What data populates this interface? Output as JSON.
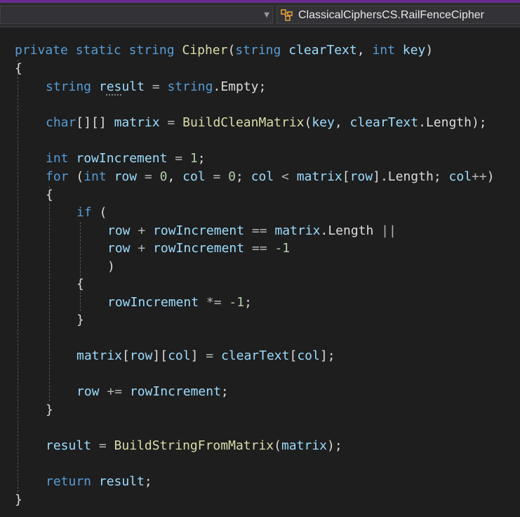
{
  "navbar": {
    "class_name": "ClassicalCiphersCS.RailFenceCipher",
    "class_icon": "class-icon"
  },
  "code": [
    {
      "line": 1,
      "indent": 0,
      "tokens": [
        {
          "t": "private",
          "c": "kw"
        },
        {
          "t": " ",
          "c": "pn"
        },
        {
          "t": "static",
          "c": "kw"
        },
        {
          "t": " ",
          "c": "pn"
        },
        {
          "t": "string",
          "c": "ty"
        },
        {
          "t": " ",
          "c": "pn"
        },
        {
          "t": "Cipher",
          "c": "fn"
        },
        {
          "t": "(",
          "c": "pn"
        },
        {
          "t": "string",
          "c": "ty"
        },
        {
          "t": " ",
          "c": "pn"
        },
        {
          "t": "clearText",
          "c": "vr"
        },
        {
          "t": ", ",
          "c": "pn"
        },
        {
          "t": "int",
          "c": "ty"
        },
        {
          "t": " ",
          "c": "pn"
        },
        {
          "t": "key",
          "c": "vr"
        },
        {
          "t": ")",
          "c": "pn"
        }
      ]
    },
    {
      "line": 2,
      "indent": 0,
      "tokens": [
        {
          "t": "{",
          "c": "pn"
        }
      ]
    },
    {
      "line": 3,
      "indent": 1,
      "tokens": [
        {
          "t": "string",
          "c": "ty"
        },
        {
          "t": " ",
          "c": "pn"
        },
        {
          "t": "r",
          "c": "vr"
        },
        {
          "t": "es",
          "c": "vr",
          "squiggle": true
        },
        {
          "t": "ult",
          "c": "vr"
        },
        {
          "t": " = ",
          "c": "op"
        },
        {
          "t": "string",
          "c": "ty"
        },
        {
          "t": ".",
          "c": "pn"
        },
        {
          "t": "Empty",
          "c": "pn"
        },
        {
          "t": ";",
          "c": "pn"
        }
      ]
    },
    {
      "line": 4,
      "indent": 0,
      "tokens": []
    },
    {
      "line": 5,
      "indent": 1,
      "tokens": [
        {
          "t": "char",
          "c": "ty"
        },
        {
          "t": "[][]",
          "c": "pn"
        },
        {
          "t": " ",
          "c": "pn"
        },
        {
          "t": "matrix",
          "c": "vr"
        },
        {
          "t": " = ",
          "c": "op"
        },
        {
          "t": "BuildCleanMatrix",
          "c": "fn"
        },
        {
          "t": "(",
          "c": "pn"
        },
        {
          "t": "key",
          "c": "vr"
        },
        {
          "t": ", ",
          "c": "pn"
        },
        {
          "t": "clearText",
          "c": "vr"
        },
        {
          "t": ".",
          "c": "pn"
        },
        {
          "t": "Length",
          "c": "pn"
        },
        {
          "t": ");",
          "c": "pn"
        }
      ]
    },
    {
      "line": 6,
      "indent": 0,
      "tokens": []
    },
    {
      "line": 7,
      "indent": 1,
      "tokens": [
        {
          "t": "int",
          "c": "ty"
        },
        {
          "t": " ",
          "c": "pn"
        },
        {
          "t": "rowIncrement",
          "c": "vr"
        },
        {
          "t": " = ",
          "c": "op"
        },
        {
          "t": "1",
          "c": "nm"
        },
        {
          "t": ";",
          "c": "pn"
        }
      ]
    },
    {
      "line": 8,
      "indent": 1,
      "tokens": [
        {
          "t": "for",
          "c": "kw"
        },
        {
          "t": " (",
          "c": "pn"
        },
        {
          "t": "int",
          "c": "ty"
        },
        {
          "t": " ",
          "c": "pn"
        },
        {
          "t": "row",
          "c": "vr"
        },
        {
          "t": " = ",
          "c": "op"
        },
        {
          "t": "0",
          "c": "nm"
        },
        {
          "t": ", ",
          "c": "pn"
        },
        {
          "t": "col",
          "c": "vr"
        },
        {
          "t": " = ",
          "c": "op"
        },
        {
          "t": "0",
          "c": "nm"
        },
        {
          "t": "; ",
          "c": "pn"
        },
        {
          "t": "col",
          "c": "vr"
        },
        {
          "t": " < ",
          "c": "op"
        },
        {
          "t": "matrix",
          "c": "vr"
        },
        {
          "t": "[",
          "c": "pn"
        },
        {
          "t": "row",
          "c": "vr"
        },
        {
          "t": "].",
          "c": "pn"
        },
        {
          "t": "Length",
          "c": "pn"
        },
        {
          "t": "; ",
          "c": "pn"
        },
        {
          "t": "col",
          "c": "vr"
        },
        {
          "t": "++",
          "c": "op"
        },
        {
          "t": ")",
          "c": "pn"
        }
      ]
    },
    {
      "line": 9,
      "indent": 1,
      "tokens": [
        {
          "t": "{",
          "c": "pn"
        }
      ]
    },
    {
      "line": 10,
      "indent": 2,
      "tokens": [
        {
          "t": "if",
          "c": "kw"
        },
        {
          "t": " (",
          "c": "pn"
        }
      ]
    },
    {
      "line": 11,
      "indent": 3,
      "tokens": [
        {
          "t": "row",
          "c": "vr"
        },
        {
          "t": " + ",
          "c": "op"
        },
        {
          "t": "rowIncrement",
          "c": "vr"
        },
        {
          "t": " == ",
          "c": "op"
        },
        {
          "t": "matrix",
          "c": "vr"
        },
        {
          "t": ".",
          "c": "pn"
        },
        {
          "t": "Length",
          "c": "pn"
        },
        {
          "t": " ||",
          "c": "op"
        }
      ]
    },
    {
      "line": 12,
      "indent": 3,
      "tokens": [
        {
          "t": "row",
          "c": "vr"
        },
        {
          "t": " + ",
          "c": "op"
        },
        {
          "t": "rowIncrement",
          "c": "vr"
        },
        {
          "t": " == ",
          "c": "op"
        },
        {
          "t": "-1",
          "c": "nm"
        }
      ]
    },
    {
      "line": 13,
      "indent": 3,
      "tokens": [
        {
          "t": ")",
          "c": "pn"
        }
      ]
    },
    {
      "line": 14,
      "indent": 2,
      "tokens": [
        {
          "t": "{",
          "c": "pn"
        }
      ]
    },
    {
      "line": 15,
      "indent": 3,
      "tokens": [
        {
          "t": "rowIncrement",
          "c": "vr"
        },
        {
          "t": " *= ",
          "c": "op"
        },
        {
          "t": "-1",
          "c": "nm"
        },
        {
          "t": ";",
          "c": "pn"
        }
      ]
    },
    {
      "line": 16,
      "indent": 2,
      "tokens": [
        {
          "t": "}",
          "c": "pn"
        }
      ]
    },
    {
      "line": 17,
      "indent": 0,
      "tokens": []
    },
    {
      "line": 18,
      "indent": 2,
      "tokens": [
        {
          "t": "matrix",
          "c": "vr"
        },
        {
          "t": "[",
          "c": "pn"
        },
        {
          "t": "row",
          "c": "vr"
        },
        {
          "t": "][",
          "c": "pn"
        },
        {
          "t": "col",
          "c": "vr"
        },
        {
          "t": "]",
          "c": "pn"
        },
        {
          "t": " = ",
          "c": "op"
        },
        {
          "t": "clearText",
          "c": "vr"
        },
        {
          "t": "[",
          "c": "pn"
        },
        {
          "t": "col",
          "c": "vr"
        },
        {
          "t": "];",
          "c": "pn"
        }
      ]
    },
    {
      "line": 19,
      "indent": 0,
      "tokens": []
    },
    {
      "line": 20,
      "indent": 2,
      "tokens": [
        {
          "t": "row",
          "c": "vr"
        },
        {
          "t": " += ",
          "c": "op"
        },
        {
          "t": "rowIncrement",
          "c": "vr"
        },
        {
          "t": ";",
          "c": "pn"
        }
      ]
    },
    {
      "line": 21,
      "indent": 1,
      "tokens": [
        {
          "t": "}",
          "c": "pn"
        }
      ]
    },
    {
      "line": 22,
      "indent": 0,
      "tokens": []
    },
    {
      "line": 23,
      "indent": 1,
      "tokens": [
        {
          "t": "result",
          "c": "vr"
        },
        {
          "t": " = ",
          "c": "op"
        },
        {
          "t": "BuildStringFromMatrix",
          "c": "fn"
        },
        {
          "t": "(",
          "c": "pn"
        },
        {
          "t": "matrix",
          "c": "vr"
        },
        {
          "t": ");",
          "c": "pn"
        }
      ]
    },
    {
      "line": 24,
      "indent": 0,
      "tokens": []
    },
    {
      "line": 25,
      "indent": 1,
      "tokens": [
        {
          "t": "return",
          "c": "kw"
        },
        {
          "t": " ",
          "c": "pn"
        },
        {
          "t": "result",
          "c": "vr"
        },
        {
          "t": ";",
          "c": "pn"
        }
      ]
    },
    {
      "line": 26,
      "indent": 0,
      "tokens": [
        {
          "t": "}",
          "c": "pn"
        }
      ]
    }
  ]
}
